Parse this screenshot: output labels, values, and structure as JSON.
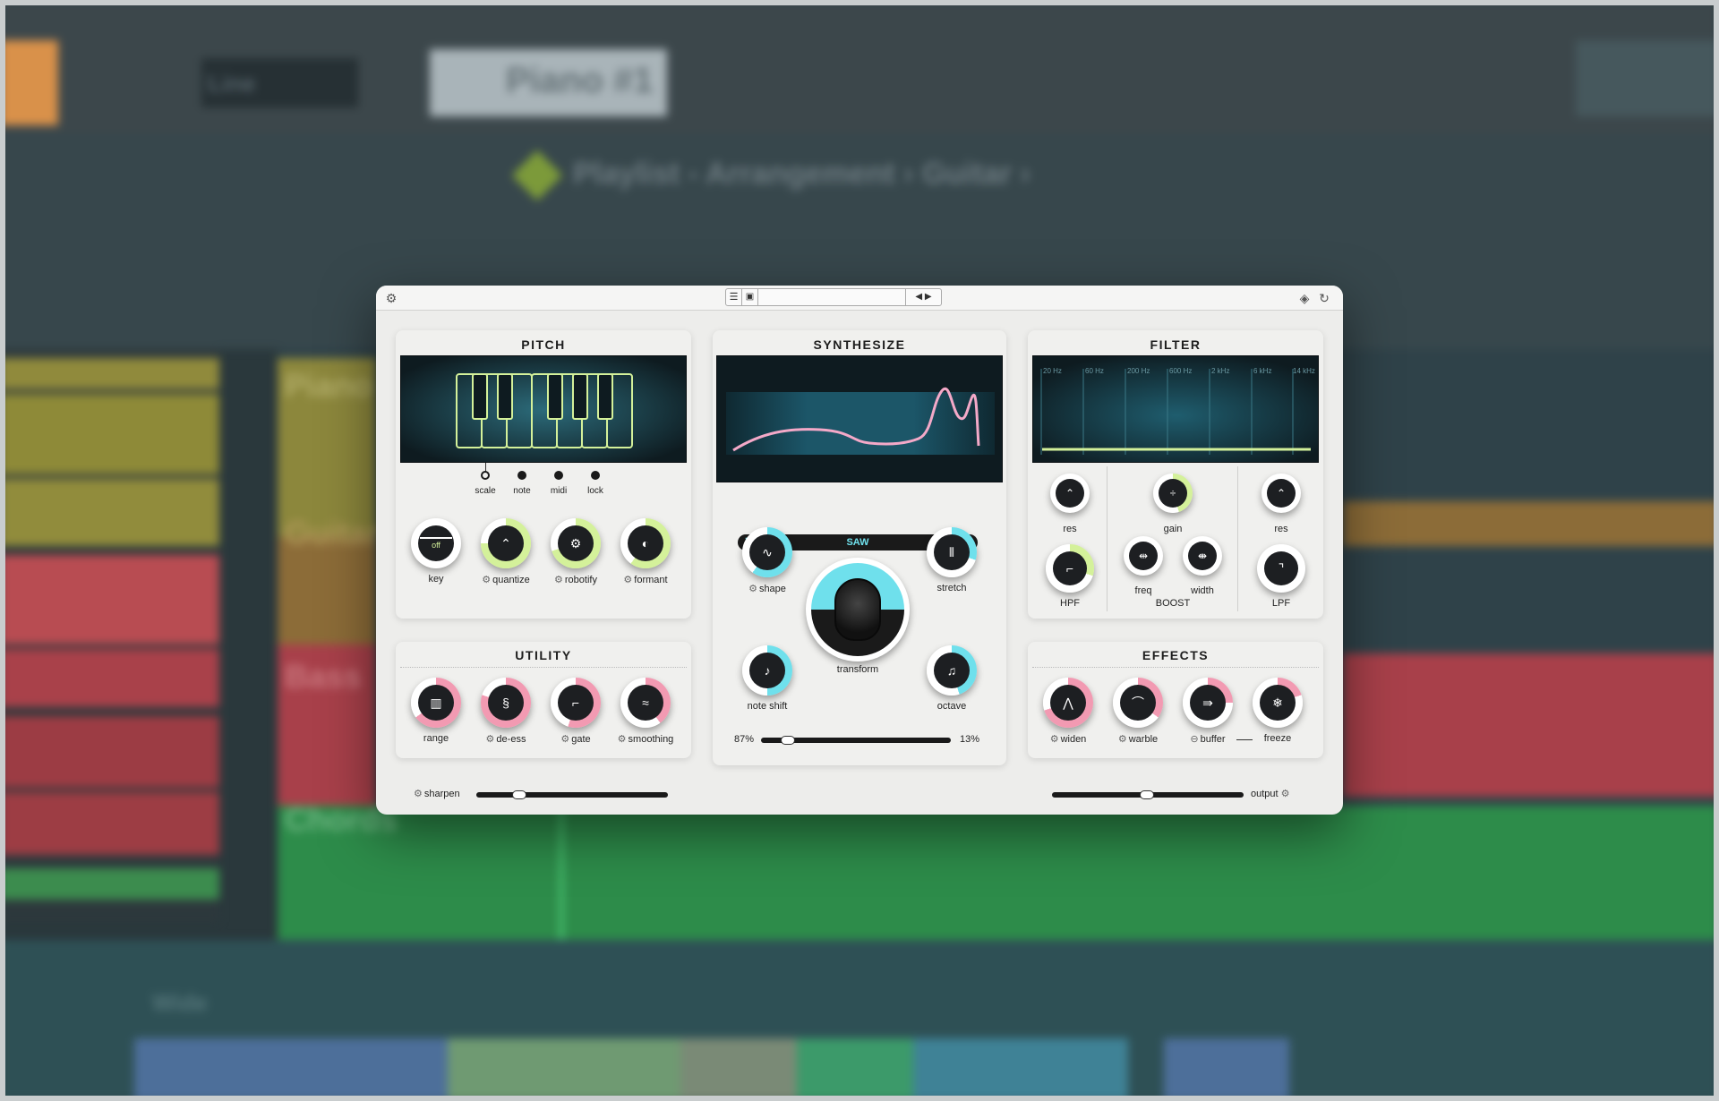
{
  "background": {
    "toolbar_preset": "Piano #1",
    "breadcrumb": "Playlist - Arrangement › Guitar ›",
    "tracks": [
      "Piano",
      "Guitar",
      "Bass",
      "Chords"
    ],
    "line_mode": "Line",
    "wide_label": "Wide"
  },
  "titlebar": {
    "settings_icon": "gear-icon",
    "menu_icon": "hamburger-icon",
    "save_icon": "save-icon",
    "prev_icon": "triangle-left-icon",
    "next_icon": "triangle-right-icon",
    "layers_icon": "layers-icon",
    "reset_icon": "undo-icon"
  },
  "pitch": {
    "title": "PITCH",
    "modes": [
      "scale",
      "note",
      "midi",
      "lock"
    ],
    "knobs": [
      {
        "label": "key",
        "value": "off",
        "gear": false
      },
      {
        "label": "quantize",
        "gear": true
      },
      {
        "label": "robotify",
        "gear": true
      },
      {
        "label": "formant",
        "gear": true
      }
    ]
  },
  "utility": {
    "title": "UTILITY",
    "knobs": [
      {
        "label": "range",
        "gear": false
      },
      {
        "label": "de-ess",
        "gear": true
      },
      {
        "label": "gate",
        "gear": true
      },
      {
        "label": "smoothing",
        "gear": true
      }
    ],
    "sharpen_label": "sharpen"
  },
  "synthesize": {
    "title": "SYNTHESIZE",
    "waveform": "SAW",
    "knobs": {
      "shape": "shape",
      "stretch": "stretch",
      "transform": "transform",
      "note_shift": "note shift",
      "octave": "octave"
    },
    "mix_left": "87%",
    "mix_right": "13%"
  },
  "filter": {
    "title": "FILTER",
    "freq_labels": [
      "20 Hz",
      "60 Hz",
      "200 Hz",
      "600 Hz",
      "2 kHz",
      "6 kHz",
      "14 kHz"
    ],
    "hpf_res": "res",
    "hpf": "HPF",
    "gain": "gain",
    "freq": "freq",
    "width": "width",
    "boost": "BOOST",
    "lpf_res": "res",
    "lpf": "LPF"
  },
  "effects": {
    "title": "EFFECTS",
    "knobs": [
      {
        "label": "widen",
        "gear": true
      },
      {
        "label": "warble",
        "gear": true
      },
      {
        "label": "buffer",
        "link": true
      },
      {
        "label": "freeze",
        "gear": false
      }
    ],
    "output_label": "output"
  },
  "colors": {
    "lime": "#d4f19a",
    "cyan": "#6fe0ec",
    "pink": "#f29ab2",
    "pink_line": "#f4a9c8"
  }
}
